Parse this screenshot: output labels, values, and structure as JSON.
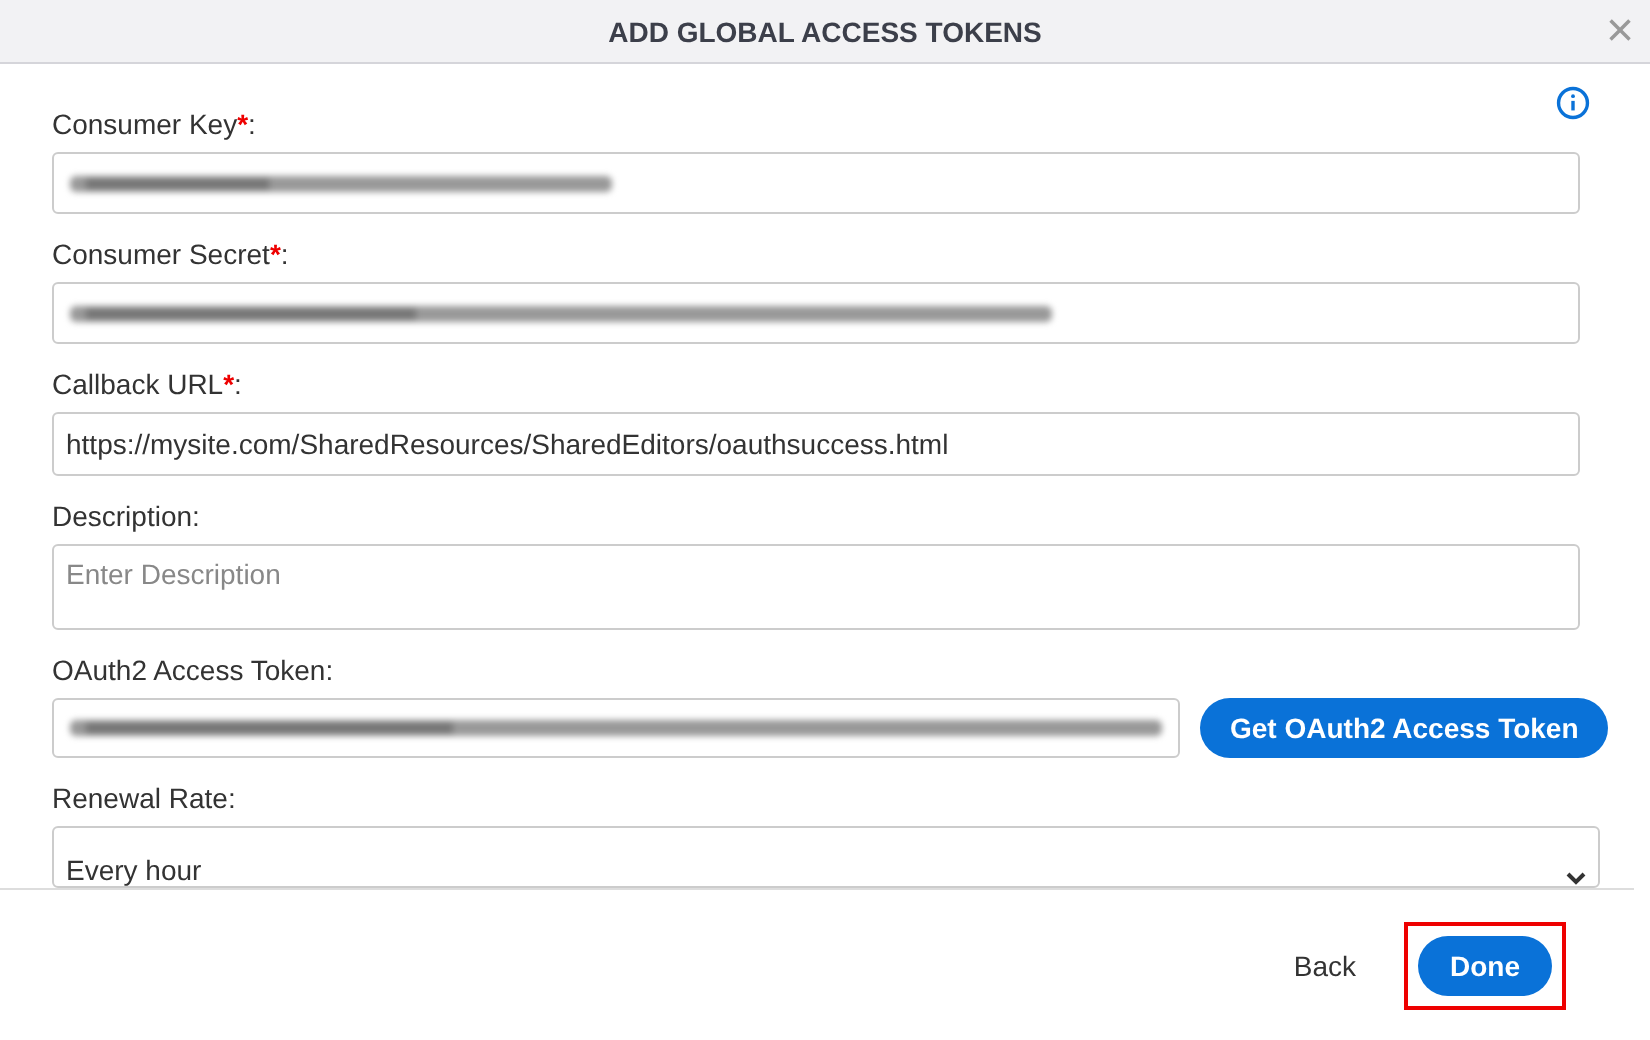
{
  "dialog": {
    "title": "ADD GLOBAL ACCESS TOKENS",
    "close": "×"
  },
  "fields": [
    {
      "kind": "redacted",
      "label": "Consumer Key",
      "required_mark": "*",
      "suffix": ":"
    },
    {
      "kind": "redacted",
      "label": "Consumer Secret",
      "required_mark": "*",
      "suffix": ":"
    },
    {
      "kind": "text",
      "label": "Callback URL",
      "required_mark": "*",
      "suffix": ":",
      "value": "https://mysite.com/SharedResources/SharedEditors/oauthsuccess.html"
    },
    {
      "kind": "textarea",
      "label": "Description",
      "suffix": ":",
      "placeholder": "Enter Description"
    },
    {
      "kind": "token",
      "label": "OAuth2 Access Token",
      "suffix": ":",
      "button": "Get OAuth2 Access Token"
    },
    {
      "kind": "select",
      "label": "Renewal Rate",
      "suffix": ":",
      "value": "Every hour"
    }
  ],
  "footer": {
    "buttons": [
      {
        "label": "Back",
        "primary": false,
        "highlighted": false
      },
      {
        "label": "Done",
        "primary": true,
        "highlighted": true
      }
    ]
  }
}
